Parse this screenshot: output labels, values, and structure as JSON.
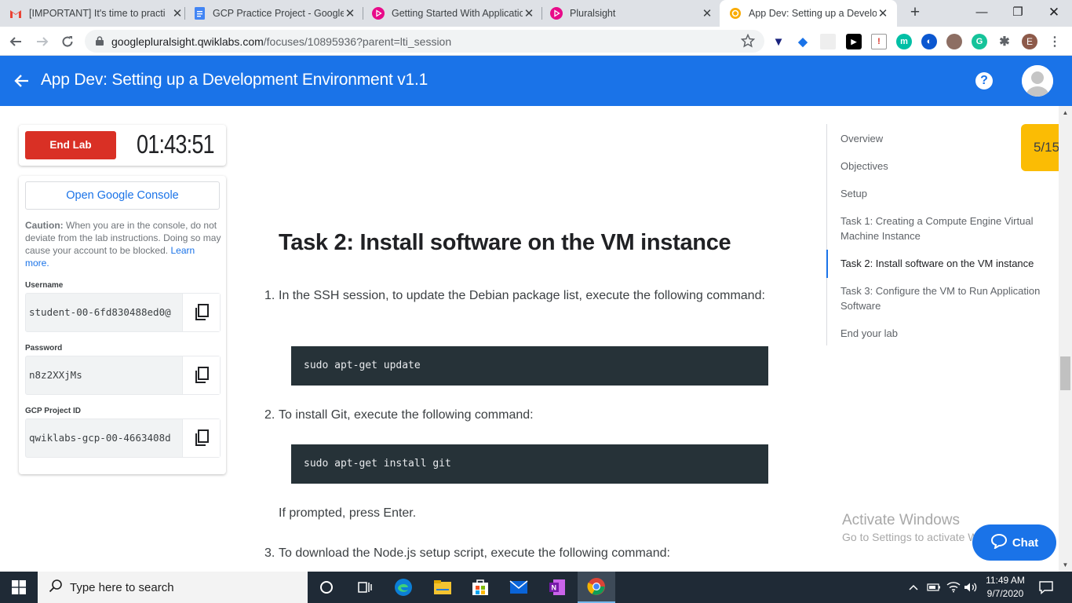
{
  "browser": {
    "tabs": [
      {
        "title": "[IMPORTANT] It's time to practi",
        "icon": "gmail-icon"
      },
      {
        "title": "GCP Practice Project - Google D",
        "icon": "google-docs-icon"
      },
      {
        "title": "Getting Started With Applicatio",
        "icon": "pluralsight-icon"
      },
      {
        "title": "Pluralsight",
        "icon": "pluralsight-icon"
      },
      {
        "title": "App Dev: Setting up a Develop",
        "icon": "qwiklabs-icon",
        "active": true
      }
    ],
    "url_host": "googlepluralsight.qwiklabs.com",
    "url_path": "/focuses/10895936?parent=lti_session",
    "profile_initial": "E"
  },
  "header": {
    "title": "App Dev: Setting up a Development Environment v1.1",
    "help_label": "?"
  },
  "lab": {
    "end_label": "End Lab",
    "timer": "01:43:51",
    "console_label": "Open Google Console",
    "caution_bold": "Caution:",
    "caution_text": " When you are in the console, do not deviate from the lab instructions. Doing so may cause your account to be blocked.",
    "learn_more": "Learn more.",
    "username_label": "Username",
    "username": "student-00-6fd830488ed0@",
    "password_label": "Password",
    "password": "n8z2XXjMs",
    "project_label": "GCP Project ID",
    "project_id": "qwiklabs-gcp-00-4663408d"
  },
  "content": {
    "heading": "Task 2: Install software on the VM instance",
    "step1_num": "1.",
    "step1_text": "In the SSH session, to update the Debian package list, execute the following command:",
    "code1": "sudo apt-get update",
    "step2_num": "2.",
    "step2_text": "To install Git, execute the following command:",
    "code2": "sudo apt-get install git",
    "prompt_text": "If prompted, press Enter.",
    "step3_num": "3.",
    "step3_text": "To download the Node.js setup script, execute the following command:"
  },
  "toc": {
    "items": [
      "Overview",
      "Objectives",
      "Setup",
      "Task 1: Creating a Compute Engine Virtual Machine Instance",
      "Task 2: Install software on the VM instance",
      "Task 3: Configure the VM to Run Application Software",
      "End your lab"
    ],
    "active_index": 4
  },
  "progress": "5/15",
  "watermark": {
    "line1": "Activate Windows",
    "line2": "Go to Settings to activate Windows."
  },
  "chat_label": "Chat",
  "taskbar": {
    "search_placeholder": "Type here to search",
    "time": "11:49 AM",
    "date": "9/7/2020"
  },
  "colors": {
    "accent": "#1a73e8",
    "end_lab": "#d93025",
    "progress": "#fbbc04",
    "code_bg": "#263238"
  }
}
